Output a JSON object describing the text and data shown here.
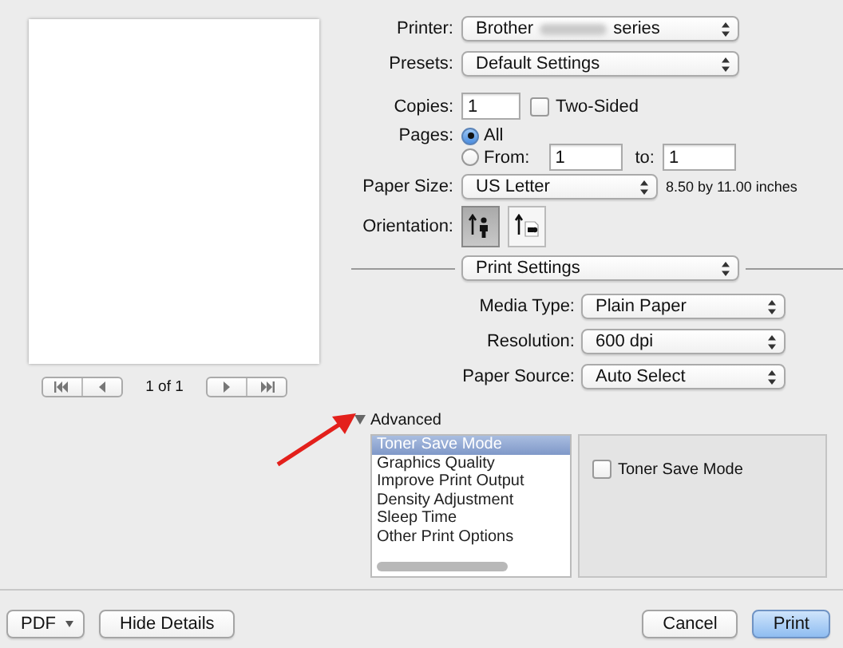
{
  "preview": {
    "page_indicator": "1 of 1"
  },
  "printer": {
    "label": "Printer:",
    "value_start": "Brother",
    "value_end": "series"
  },
  "presets": {
    "label": "Presets:",
    "value": "Default Settings"
  },
  "copies": {
    "label": "Copies:",
    "value": "1"
  },
  "two_sided": {
    "label": "Two-Sided",
    "checked": false
  },
  "pages": {
    "label": "Pages:",
    "options": [
      {
        "label": "All",
        "selected": true
      },
      {
        "label": "From:",
        "selected": false
      }
    ],
    "from": "1",
    "to_label": "to:",
    "to": "1"
  },
  "paper_size": {
    "label": "Paper Size:",
    "value": "US Letter",
    "dimensions": "8.50 by 11.00 inches"
  },
  "orientation": {
    "label": "Orientation:",
    "options": [
      {
        "kind": "portrait",
        "selected": true
      },
      {
        "kind": "landscape",
        "selected": false
      }
    ]
  },
  "section": {
    "value": "Print Settings"
  },
  "settings": [
    {
      "label": "Media Type:",
      "value": "Plain Paper"
    },
    {
      "label": "Resolution:",
      "value": "600 dpi"
    },
    {
      "label": "Paper Source:",
      "value": "Auto Select"
    }
  ],
  "advanced": {
    "label": "Advanced",
    "expanded": true,
    "items": [
      {
        "label": "Toner Save Mode",
        "selected": true
      },
      {
        "label": "Graphics Quality",
        "selected": false
      },
      {
        "label": "Improve Print Output",
        "selected": false
      },
      {
        "label": "Density Adjustment",
        "selected": false
      },
      {
        "label": "Sleep Time",
        "selected": false
      },
      {
        "label": "Other Print Options",
        "selected": false
      }
    ],
    "options": [
      {
        "label": "Toner Save Mode",
        "checked": false
      }
    ]
  },
  "footer": {
    "left_buttons": [
      {
        "label": "PDF",
        "kind": "menu"
      },
      {
        "label": "Hide Details",
        "kind": "normal"
      }
    ],
    "right_buttons": [
      {
        "label": "Cancel",
        "kind": "normal"
      },
      {
        "label": "Print",
        "kind": "default"
      }
    ]
  }
}
